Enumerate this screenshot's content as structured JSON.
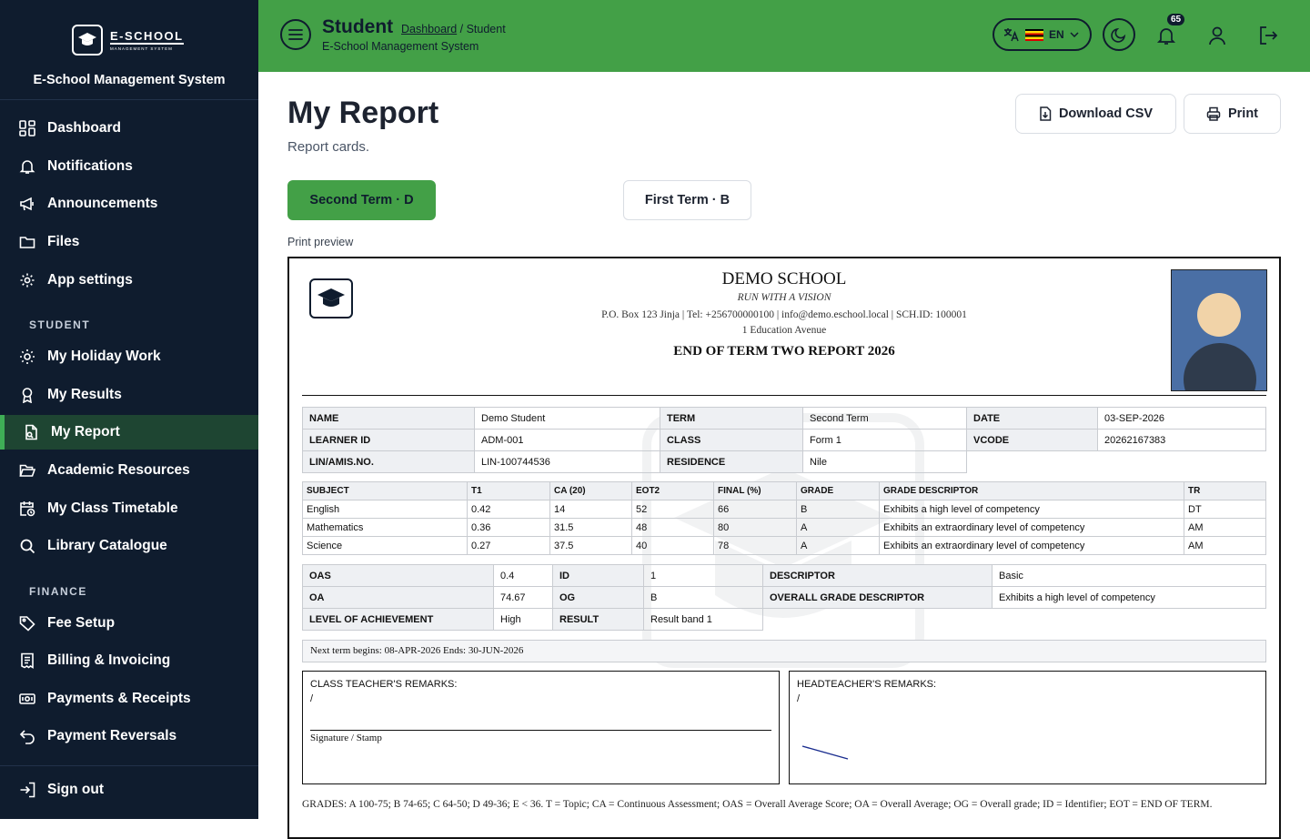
{
  "sidebar": {
    "logo_text": "E-SCHOOL",
    "logo_subtext": "MANAGEMENT SYSTEM",
    "brand_name": "E-School Management System",
    "items_main": [
      {
        "label": "Dashboard",
        "icon": "dashboard-icon"
      },
      {
        "label": "Notifications",
        "icon": "bell-icon"
      },
      {
        "label": "Announcements",
        "icon": "megaphone-icon"
      },
      {
        "label": "Files",
        "icon": "folder-icon"
      },
      {
        "label": "App settings",
        "icon": "gear-icon"
      }
    ],
    "section_student": "STUDENT",
    "items_student": [
      {
        "label": "My Holiday Work",
        "icon": "sun-icon"
      },
      {
        "label": "My Results",
        "icon": "award-icon"
      },
      {
        "label": "My Report",
        "icon": "report-icon",
        "active": true
      },
      {
        "label": "Academic Resources",
        "icon": "folder-open-icon"
      },
      {
        "label": "My Class Timetable",
        "icon": "calendar-clock-icon"
      },
      {
        "label": "Library Catalogue",
        "icon": "search-icon"
      }
    ],
    "section_finance": "FINANCE",
    "items_finance": [
      {
        "label": "Fee Setup",
        "icon": "tag-icon"
      },
      {
        "label": "Billing & Invoicing",
        "icon": "invoice-icon"
      },
      {
        "label": "Payments & Receipts",
        "icon": "cash-icon"
      },
      {
        "label": "Payment Reversals",
        "icon": "undo-icon"
      }
    ],
    "sign_out": "Sign out"
  },
  "topbar": {
    "title": "Student",
    "breadcrumb_link": "Dashboard",
    "breadcrumb_current": " / Student",
    "subtitle": "E-School Management System",
    "language": "EN",
    "notification_count": "65",
    "accent": "#43a047"
  },
  "page": {
    "title": "My Report",
    "subtitle": "Report cards.",
    "download_csv": "Download CSV",
    "print": "Print",
    "term_active": "Second Term · D",
    "term_other": "First Term · B",
    "print_preview": "Print preview"
  },
  "report": {
    "school_name": "DEMO SCHOOL",
    "motto": "RUN WITH A VISION",
    "contact": "P.O. Box 123 Jinja | Tel: +256700000100 | info@demo.eschool.local | SCH.ID: 100001",
    "address": "1 Education Avenue",
    "report_title": "END OF TERM TWO REPORT 2026",
    "info": {
      "name_lbl": "NAME",
      "name": "Demo Student",
      "term_lbl": "TERM",
      "term": "Second Term",
      "date_lbl": "DATE",
      "date": "03-SEP-2026",
      "learner_lbl": "LEARNER ID",
      "learner": "ADM-001",
      "class_lbl": "CLASS",
      "class": "Form 1",
      "vcode_lbl": "VCODE",
      "vcode": "20262167383",
      "lin_lbl": "LIN/AMIS.NO.",
      "lin": "LIN-100744536",
      "residence_lbl": "RESIDENCE",
      "residence": "Nile"
    },
    "subjects_header": [
      "SUBJECT",
      "T1",
      "CA (20)",
      "EOT2",
      "FINAL (%)",
      "GRADE",
      "GRADE DESCRIPTOR",
      "TR"
    ],
    "subjects": [
      [
        "English",
        "0.42",
        "14",
        "52",
        "66",
        "B",
        "Exhibits a high level of competency",
        "DT"
      ],
      [
        "Mathematics",
        "0.36",
        "31.5",
        "48",
        "80",
        "A",
        "Exhibits an extraordinary level of competency",
        "AM"
      ],
      [
        "Science",
        "0.27",
        "37.5",
        "40",
        "78",
        "A",
        "Exhibits an extraordinary level of competency",
        "AM"
      ]
    ],
    "summary": {
      "oas_lbl": "OAS",
      "oas": "0.4",
      "id_lbl": "ID",
      "id": "1",
      "descriptor_lbl": "DESCRIPTOR",
      "descriptor": "Basic",
      "oa_lbl": "OA",
      "oa": "74.67",
      "og_lbl": "OG",
      "og": "B",
      "ogd_lbl": "OVERALL GRADE DESCRIPTOR",
      "ogd": "Exhibits a high level of competency",
      "loa_lbl": "LEVEL OF ACHIEVEMENT",
      "loa": "High",
      "result_lbl": "RESULT",
      "result": "Result band 1"
    },
    "next_term": "Next term begins: 08-APR-2026 Ends: 30-JUN-2026",
    "class_teacher_title": "CLASS TEACHER'S REMARKS:",
    "class_teacher_remark": "/",
    "signature_label": "Signature / Stamp",
    "headteacher_title": "HEADTEACHER'S REMARKS:",
    "headteacher_remark": "/",
    "legend": "GRADES: A 100-75; B 74-65; C 64-50; D 49-36; E < 36. T = Topic; CA = Continuous Assessment; OAS = Overall Average Score; OA = Overall Average; OG = Overall grade; ID = Identifier; EOT = END OF TERM."
  }
}
